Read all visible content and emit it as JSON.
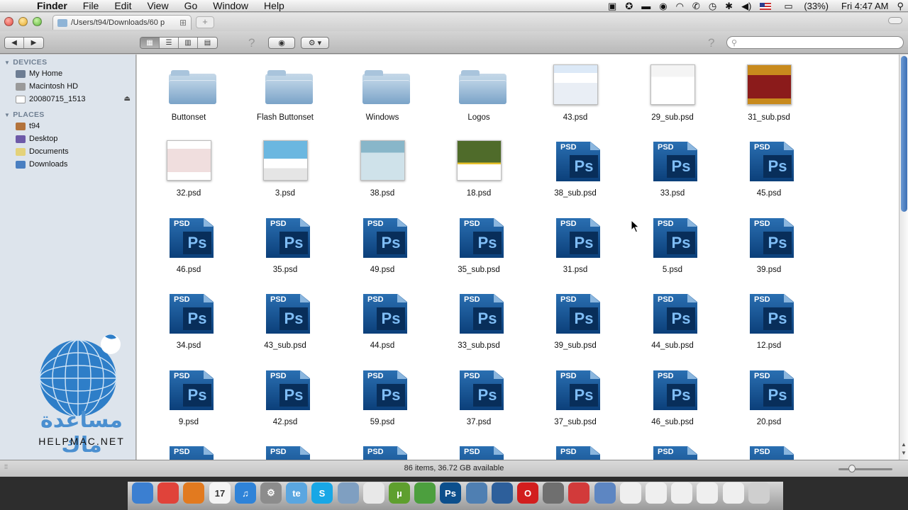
{
  "menubar": {
    "app": "Finder",
    "items": [
      "File",
      "Edit",
      "View",
      "Go",
      "Window",
      "Help"
    ],
    "battery": "(33%)",
    "clock": "Fri 4:47 AM"
  },
  "window": {
    "tab_title": "/Users/t94/Downloads/60 p"
  },
  "sidebar": {
    "devices_header": "DEVICES",
    "devices": [
      "My Home",
      "Macintosh HD",
      "20080715_1513"
    ],
    "places_header": "PLACES",
    "places": [
      "t94",
      "Desktop",
      "Documents",
      "Downloads"
    ]
  },
  "files": [
    {
      "name": "Buttonset",
      "kind": "folder"
    },
    {
      "name": "Flash Buttonset",
      "kind": "folder"
    },
    {
      "name": "Windows",
      "kind": "folder"
    },
    {
      "name": "Logos",
      "kind": "folder"
    },
    {
      "name": "43.psd",
      "kind": "thumb"
    },
    {
      "name": "29_sub.psd",
      "kind": "thumb"
    },
    {
      "name": "31_sub.psd",
      "kind": "thumb"
    },
    {
      "name": "32.psd",
      "kind": "thumb"
    },
    {
      "name": "3.psd",
      "kind": "thumb"
    },
    {
      "name": "38.psd",
      "kind": "thumb"
    },
    {
      "name": "18.psd",
      "kind": "thumb"
    },
    {
      "name": "38_sub.psd",
      "kind": "psd"
    },
    {
      "name": "33.psd",
      "kind": "psd"
    },
    {
      "name": "45.psd",
      "kind": "psd"
    },
    {
      "name": "46.psd",
      "kind": "psd"
    },
    {
      "name": "35.psd",
      "kind": "psd"
    },
    {
      "name": "49.psd",
      "kind": "psd"
    },
    {
      "name": "35_sub.psd",
      "kind": "psd"
    },
    {
      "name": "31.psd",
      "kind": "psd"
    },
    {
      "name": "5.psd",
      "kind": "psd"
    },
    {
      "name": "39.psd",
      "kind": "psd"
    },
    {
      "name": "34.psd",
      "kind": "psd"
    },
    {
      "name": "43_sub.psd",
      "kind": "psd"
    },
    {
      "name": "44.psd",
      "kind": "psd"
    },
    {
      "name": "33_sub.psd",
      "kind": "psd"
    },
    {
      "name": "39_sub.psd",
      "kind": "psd"
    },
    {
      "name": "44_sub.psd",
      "kind": "psd"
    },
    {
      "name": "12.psd",
      "kind": "psd"
    },
    {
      "name": "9.psd",
      "kind": "psd"
    },
    {
      "name": "42.psd",
      "kind": "psd"
    },
    {
      "name": "59.psd",
      "kind": "psd"
    },
    {
      "name": "37.psd",
      "kind": "psd"
    },
    {
      "name": "37_sub.psd",
      "kind": "psd"
    },
    {
      "name": "46_sub.psd",
      "kind": "psd"
    },
    {
      "name": "20.psd",
      "kind": "psd"
    },
    {
      "name": "",
      "kind": "psd"
    },
    {
      "name": "",
      "kind": "psd"
    },
    {
      "name": "",
      "kind": "psd"
    },
    {
      "name": "",
      "kind": "psd"
    },
    {
      "name": "",
      "kind": "psd"
    },
    {
      "name": "",
      "kind": "psd"
    },
    {
      "name": "",
      "kind": "psd"
    }
  ],
  "psd_icon": {
    "tag": "PSD",
    "glyph": "Ps"
  },
  "status": {
    "text": "86 items, 36.72 GB available"
  },
  "watermark": {
    "arabic": "مساعدة ماك",
    "latin": "HELPMAC.NET"
  },
  "dock": {
    "icons": [
      {
        "name": "finder",
        "color": "#3b7fd1",
        "glyph": ""
      },
      {
        "name": "chrome",
        "color": "#e0433a",
        "glyph": ""
      },
      {
        "name": "firefox",
        "color": "#e27a1f",
        "glyph": ""
      },
      {
        "name": "ical",
        "color": "#f4f4f4",
        "glyph": "17"
      },
      {
        "name": "itunes",
        "color": "#2f83d8",
        "glyph": "♫"
      },
      {
        "name": "preferences",
        "color": "#8c8c8c",
        "glyph": "⚙"
      },
      {
        "name": "te",
        "color": "#5aa6e0",
        "glyph": "te"
      },
      {
        "name": "skype",
        "color": "#18a7e6",
        "glyph": "S"
      },
      {
        "name": "preview",
        "color": "#7f9fc1",
        "glyph": ""
      },
      {
        "name": "textedit",
        "color": "#e8e8e8",
        "glyph": ""
      },
      {
        "name": "utorrent",
        "color": "#5e9f2e",
        "glyph": "µ"
      },
      {
        "name": "tool",
        "color": "#4c9f3e",
        "glyph": ""
      },
      {
        "name": "photoshop",
        "color": "#0c4f8c",
        "glyph": "Ps"
      },
      {
        "name": "quicktime",
        "color": "#4f7fb2",
        "glyph": ""
      },
      {
        "name": "globe",
        "color": "#2d5f9b",
        "glyph": ""
      },
      {
        "name": "opera",
        "color": "#d21e1e",
        "glyph": "O"
      },
      {
        "name": "photo-booth",
        "color": "#6f6f6f",
        "glyph": ""
      },
      {
        "name": "iso",
        "color": "#d23a3a",
        "glyph": ""
      },
      {
        "name": "applications",
        "color": "#5d86c2",
        "glyph": ""
      },
      {
        "name": "window-1",
        "color": "#efefef",
        "glyph": ""
      },
      {
        "name": "window-2",
        "color": "#efefef",
        "glyph": ""
      },
      {
        "name": "window-3",
        "color": "#efefef",
        "glyph": ""
      },
      {
        "name": "window-4",
        "color": "#efefef",
        "glyph": ""
      },
      {
        "name": "window-5",
        "color": "#efefef",
        "glyph": ""
      },
      {
        "name": "trash",
        "color": "#cfcfcf",
        "glyph": ""
      }
    ]
  }
}
